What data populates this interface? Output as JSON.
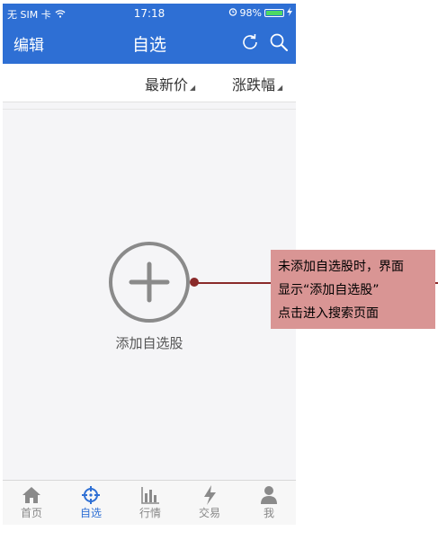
{
  "status_bar": {
    "carrier": "无 SIM 卡",
    "time": "17:18",
    "battery": "98%",
    "battery_level": 0.98
  },
  "nav": {
    "edit_label": "编辑",
    "title": "自选"
  },
  "sort_bar": {
    "price_label": "最新价",
    "change_label": "涨跌幅"
  },
  "empty_state": {
    "add_label": "添加自选股"
  },
  "tabs": [
    {
      "label": "首页",
      "icon": "home-icon",
      "active": false
    },
    {
      "label": "自选",
      "icon": "crosshair-icon",
      "active": true
    },
    {
      "label": "行情",
      "icon": "bar-chart-icon",
      "active": false
    },
    {
      "label": "交易",
      "icon": "lightning-icon",
      "active": false
    },
    {
      "label": "我",
      "icon": "user-icon",
      "active": false
    }
  ],
  "annotation": {
    "lines": [
      "未添加自选股时，界面",
      "显示“添加自选股”",
      "点击进入搜索页面"
    ]
  },
  "colors": {
    "header_blue": "#2e6fd4",
    "annotation_bg": "#d99594",
    "annotation_line": "#8a2a2a",
    "battery_green": "#4cd964"
  }
}
